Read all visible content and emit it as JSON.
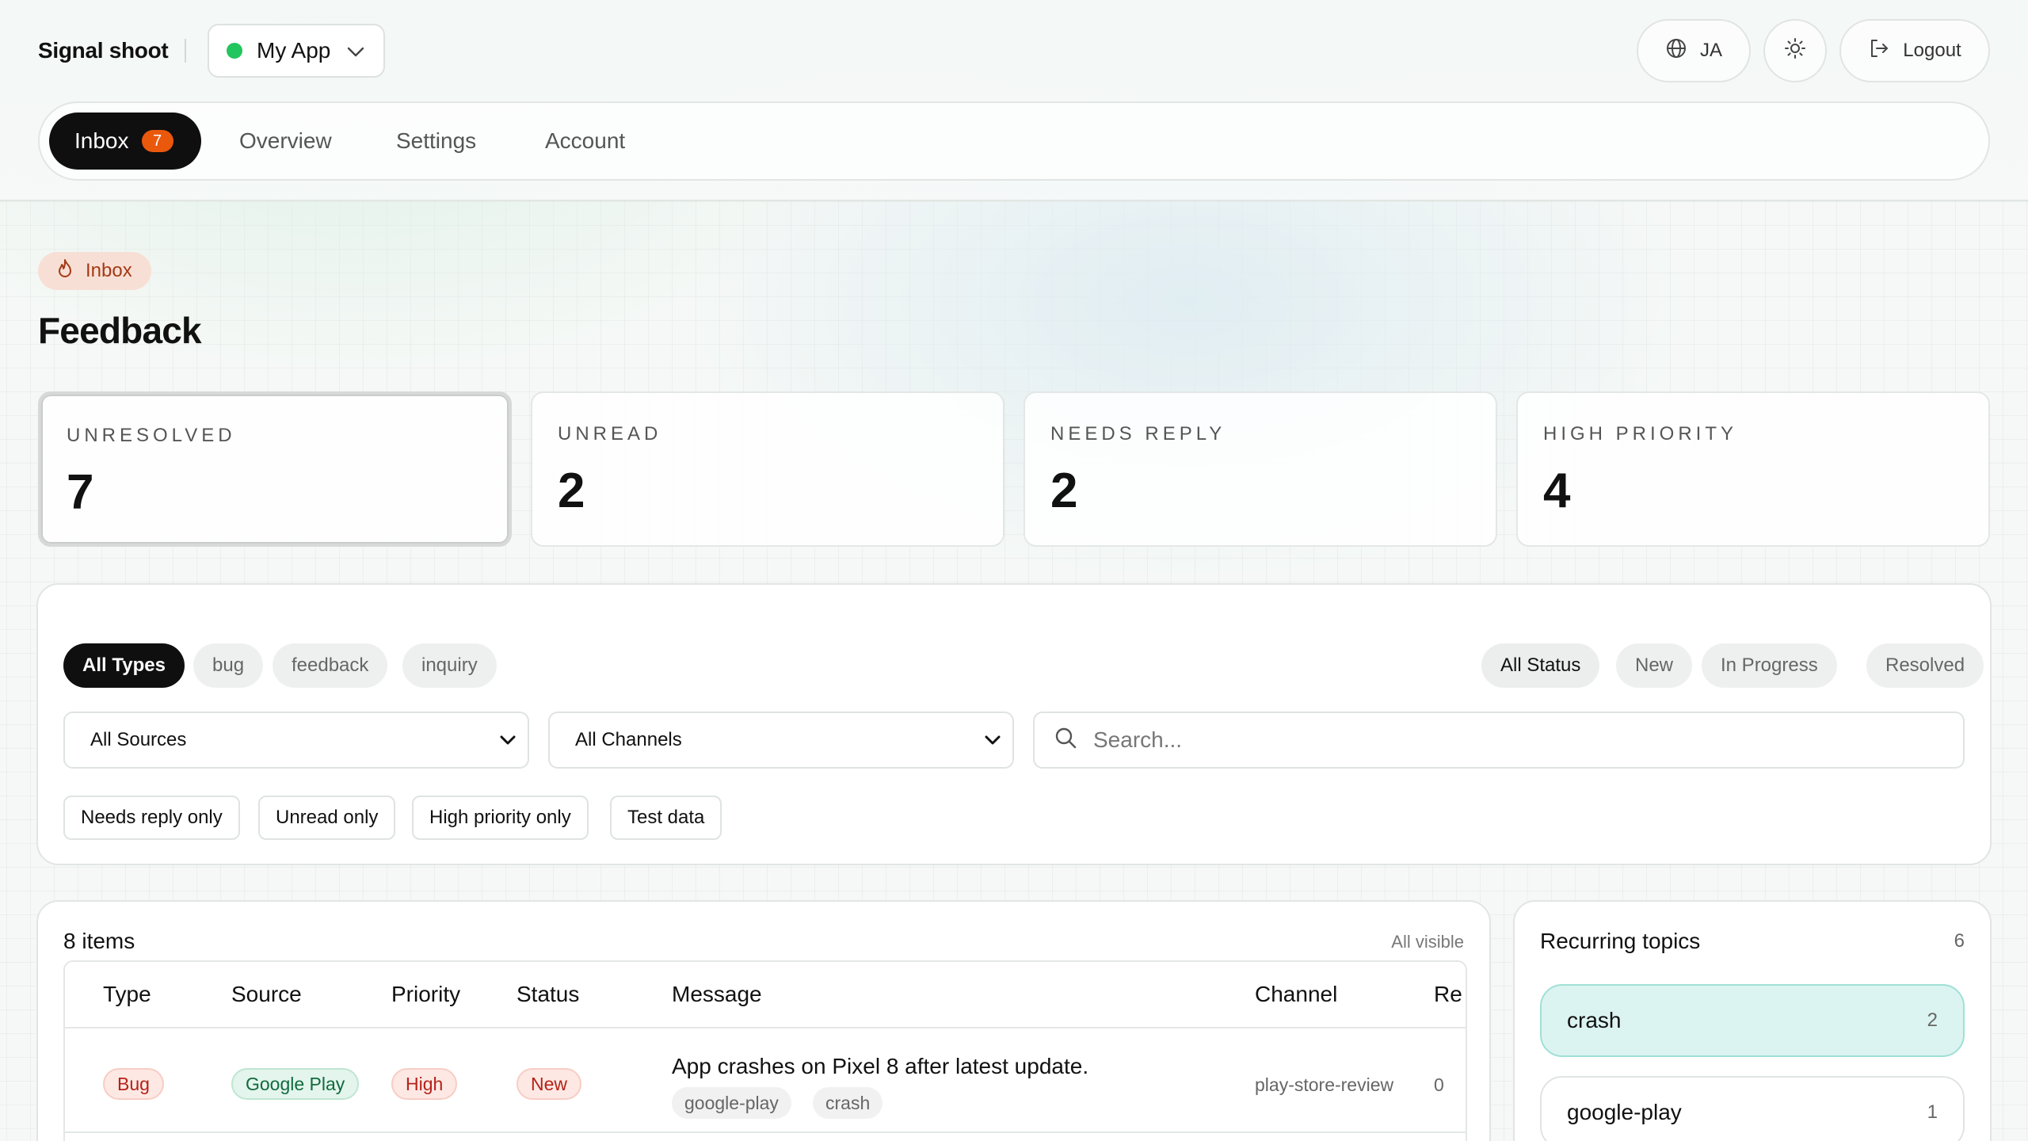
{
  "header": {
    "brand": "Signal shoot",
    "app_selector": {
      "label": "My App",
      "status_color": "#22c55e"
    },
    "language_label": "JA",
    "logout_label": "Logout"
  },
  "tabs": [
    {
      "label": "Inbox",
      "count": "7",
      "active": true
    },
    {
      "label": "Overview"
    },
    {
      "label": "Settings"
    },
    {
      "label": "Account"
    }
  ],
  "page": {
    "breadcrumb": "Inbox",
    "title": "Feedback"
  },
  "stats": [
    {
      "label": "UNRESOLVED",
      "value": "7",
      "selected": true
    },
    {
      "label": "UNREAD",
      "value": "2"
    },
    {
      "label": "NEEDS REPLY",
      "value": "2"
    },
    {
      "label": "HIGH PRIORITY",
      "value": "4"
    }
  ],
  "filters": {
    "types": [
      "All Types",
      "bug",
      "feedback",
      "inquiry"
    ],
    "statuses": [
      "All Status",
      "New",
      "In Progress",
      "Resolved"
    ],
    "source_select": "All Sources",
    "channel_select": "All Channels",
    "search_placeholder": "Search...",
    "toggles": [
      "Needs reply only",
      "Unread only",
      "High priority only",
      "Test data"
    ]
  },
  "table": {
    "items_count": "8 items",
    "visibility": "All visible",
    "columns": [
      "Type",
      "Source",
      "Priority",
      "Status",
      "Message",
      "Channel",
      "Re"
    ],
    "rows": [
      {
        "type": "Bug",
        "source": "Google Play",
        "priority": "High",
        "status": "New",
        "message": "App crashes on Pixel 8 after latest update.",
        "tags": [
          "google-play",
          "crash"
        ],
        "channel": "play-store-review",
        "replies": "0"
      }
    ]
  },
  "topics": {
    "title": "Recurring topics",
    "count": "6",
    "items": [
      {
        "label": "crash",
        "count": "2",
        "active": true
      },
      {
        "label": "google-play",
        "count": "1"
      }
    ]
  },
  "colors": {
    "accent_dark": "#0f0f0f",
    "badge_orange": "#ea580c",
    "topic_active_bg": "#dcf4f1",
    "danger_badge": "#b42318",
    "success_badge": "#116a3f"
  },
  "icons": [
    "chevron-down-icon",
    "globe-icon",
    "sun-icon",
    "logout-icon",
    "flame-icon",
    "search-icon"
  ]
}
